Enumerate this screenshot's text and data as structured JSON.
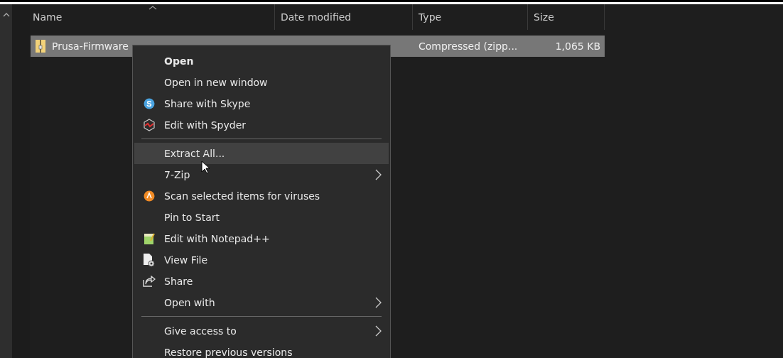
{
  "columns": [
    {
      "label": "Name",
      "sorted": true
    },
    {
      "label": "Date modified",
      "sorted": false
    },
    {
      "label": "Type",
      "sorted": false
    },
    {
      "label": "Size",
      "sorted": false
    }
  ],
  "file": {
    "name": "Prusa-Firmware",
    "type": "Compressed (zipp...",
    "size": "1,065 KB",
    "selected": true
  },
  "context_menu": [
    {
      "kind": "item",
      "label": "Open",
      "default": true,
      "highlighted": false,
      "submenu": false
    },
    {
      "kind": "item",
      "label": "Open in new window",
      "default": false,
      "highlighted": false,
      "submenu": false
    },
    {
      "kind": "item",
      "label": "Share with Skype",
      "icon_text": "S",
      "default": false,
      "highlighted": false,
      "submenu": false
    },
    {
      "kind": "item",
      "label": "Edit with Spyder",
      "default": false,
      "highlighted": false,
      "submenu": false
    },
    {
      "kind": "separator"
    },
    {
      "kind": "item",
      "label": "Extract All...",
      "default": false,
      "highlighted": true,
      "submenu": false
    },
    {
      "kind": "item",
      "label": "7-Zip",
      "default": false,
      "highlighted": false,
      "submenu": true
    },
    {
      "kind": "item",
      "label": "Scan selected items for viruses",
      "default": false,
      "highlighted": false,
      "submenu": false
    },
    {
      "kind": "item",
      "label": "Pin to Start",
      "default": false,
      "highlighted": false,
      "submenu": false
    },
    {
      "kind": "item",
      "label": "Edit with Notepad++",
      "default": false,
      "highlighted": false,
      "submenu": false
    },
    {
      "kind": "item",
      "label": "View File",
      "default": false,
      "highlighted": false,
      "submenu": false
    },
    {
      "kind": "item",
      "label": "Share",
      "default": false,
      "highlighted": false,
      "submenu": false
    },
    {
      "kind": "item",
      "label": "Open with",
      "default": false,
      "highlighted": false,
      "submenu": true
    },
    {
      "kind": "separator"
    },
    {
      "kind": "item",
      "label": "Give access to",
      "default": false,
      "highlighted": false,
      "submenu": true
    },
    {
      "kind": "item",
      "label": "Restore previous versions",
      "default": false,
      "highlighted": false,
      "submenu": false
    }
  ]
}
